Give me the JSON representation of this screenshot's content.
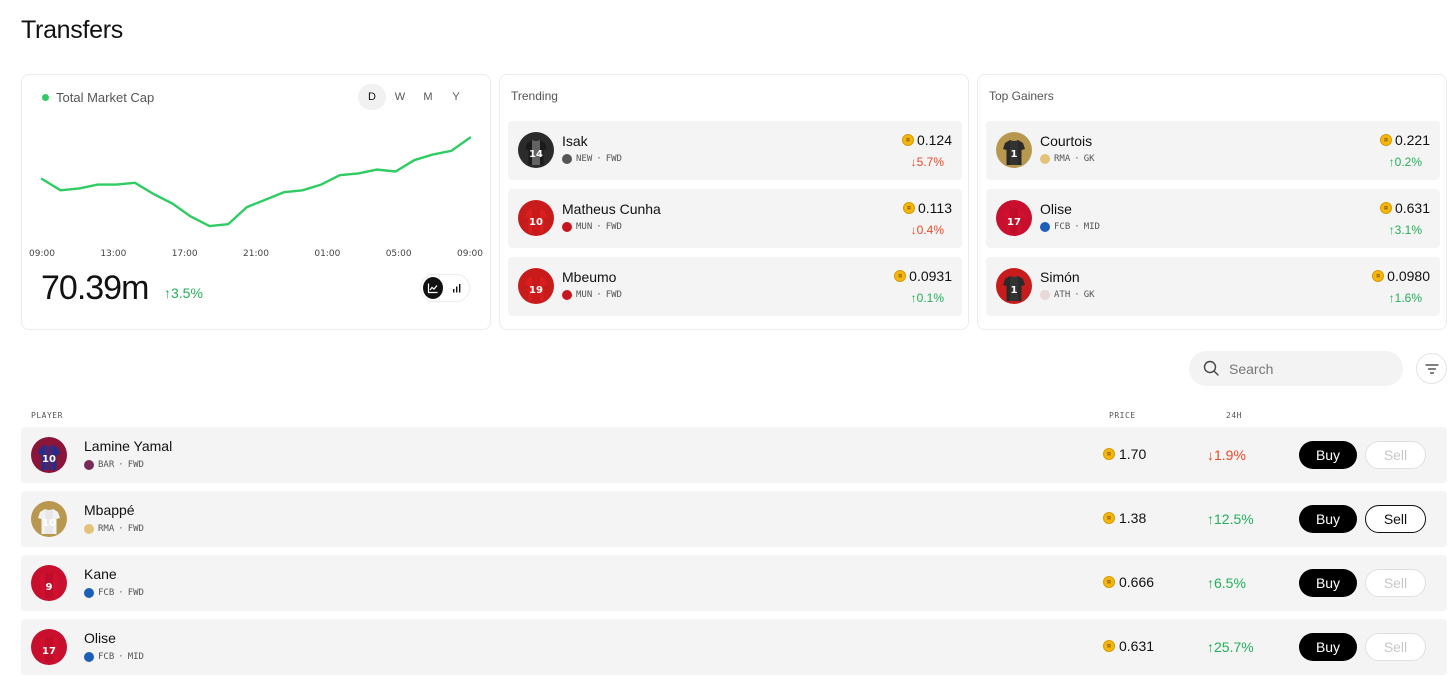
{
  "page": {
    "title": "Transfers"
  },
  "market": {
    "label": "Total Market Cap",
    "ranges": [
      "D",
      "W",
      "M",
      "Y"
    ],
    "active_range": "D",
    "value": "70.39m",
    "change": "3.5%",
    "change_dir": "up",
    "line_color": "#2fcc63",
    "view_modes": [
      "line-chart-icon",
      "bar-chart-icon"
    ],
    "active_view": "line-chart-icon"
  },
  "chart_data": {
    "type": "line",
    "x_ticks": [
      "09:00",
      "13:00",
      "17:00",
      "21:00",
      "01:00",
      "05:00",
      "09:00"
    ],
    "values": [
      70.25,
      70.22,
      70.225,
      70.235,
      70.235,
      70.24,
      70.21,
      70.185,
      70.15,
      70.125,
      70.13,
      70.175,
      70.195,
      70.215,
      70.22,
      70.235,
      70.26,
      70.265,
      70.275,
      70.27,
      70.3,
      70.315,
      70.325,
      70.36
    ],
    "ylim": [
      70.08,
      70.42
    ]
  },
  "trending": {
    "title": "Trending",
    "items": [
      {
        "name": "Isak",
        "team": "NEW",
        "position": "FWD",
        "price": "0.124",
        "change": "5.7%",
        "dir": "down",
        "kit_color": "#1b1b1b",
        "kit_stripe": "#e8e8e8",
        "avatar_bg": "#2b2b2b",
        "number": "14",
        "crest": "#555555"
      },
      {
        "name": "Matheus Cunha",
        "team": "MUN",
        "position": "FWD",
        "price": "0.113",
        "change": "0.4%",
        "dir": "down",
        "kit_color": "#d81e1e",
        "kit_stripe": "#b01010",
        "avatar_bg": "#c81c1c",
        "number": "10",
        "crest": "#c8161e"
      },
      {
        "name": "Mbeumo",
        "team": "MUN",
        "position": "FWD",
        "price": "0.0931",
        "change": "0.1%",
        "dir": "up",
        "kit_color": "#d81e1e",
        "kit_stripe": "#b01010",
        "avatar_bg": "#c81c1c",
        "number": "19",
        "crest": "#c8161e"
      }
    ]
  },
  "gainers": {
    "title": "Top Gainers",
    "items": [
      {
        "name": "Courtois",
        "team": "RMA",
        "position": "GK",
        "price": "0.221",
        "change": "0.2%",
        "dir": "up",
        "kit_color": "#2a2a2a",
        "kit_stripe": "#444444",
        "avatar_bg": "#b8984f",
        "number": "1",
        "crest": "#e3c37a"
      },
      {
        "name": "Olise",
        "team": "FCB",
        "position": "MID",
        "price": "0.631",
        "change": "3.1%",
        "dir": "up",
        "kit_color": "#d0102e",
        "kit_stripe": "#a00a22",
        "avatar_bg": "#c8102e",
        "number": "17",
        "crest": "#1c5fb8"
      },
      {
        "name": "Simón",
        "team": "ATH",
        "position": "GK",
        "price": "0.0980",
        "change": "1.6%",
        "dir": "up",
        "kit_color": "#2a2a2a",
        "kit_stripe": "#444444",
        "avatar_bg": "#c81c1c",
        "number": "1",
        "crest": "#e8d8d8"
      }
    ]
  },
  "search": {
    "placeholder": "Search"
  },
  "table": {
    "columns": {
      "player": "PLAYER",
      "price": "PRICE",
      "change": "24H"
    },
    "buy_label": "Buy",
    "sell_label": "Sell",
    "rows": [
      {
        "name": "Lamine Yamal",
        "team": "BAR",
        "position": "FWD",
        "price": "1.70",
        "change": "1.9%",
        "dir": "down",
        "sell_enabled": false,
        "kit_color": "#1f2f8a",
        "kit_stripe": "#a3123a",
        "avatar_bg": "#8a1538",
        "number": "10",
        "crest": "#7a2a5a"
      },
      {
        "name": "Mbappé",
        "team": "RMA",
        "position": "FWD",
        "price": "1.38",
        "change": "12.5%",
        "dir": "up",
        "sell_enabled": true,
        "kit_color": "#f2f2f2",
        "kit_stripe": "#d8d8d8",
        "avatar_bg": "#b8984f",
        "number": "10",
        "crest": "#e3c37a"
      },
      {
        "name": "Kane",
        "team": "FCB",
        "position": "FWD",
        "price": "0.666",
        "change": "6.5%",
        "dir": "up",
        "sell_enabled": false,
        "kit_color": "#d0102e",
        "kit_stripe": "#a00a22",
        "avatar_bg": "#c8102e",
        "number": "9",
        "crest": "#1c5fb8"
      },
      {
        "name": "Olise",
        "team": "FCB",
        "position": "MID",
        "price": "0.631",
        "change": "25.7%",
        "dir": "up",
        "sell_enabled": false,
        "kit_color": "#d0102e",
        "kit_stripe": "#a00a22",
        "avatar_bg": "#c8102e",
        "number": "17",
        "crest": "#1c5fb8"
      }
    ]
  }
}
